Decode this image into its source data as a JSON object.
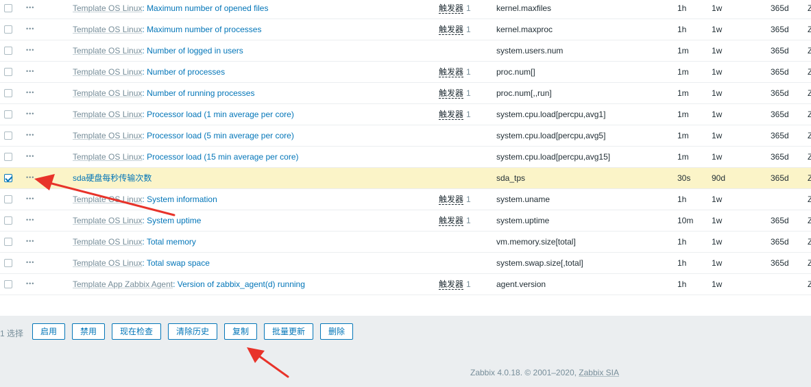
{
  "trigger_label": "触发器",
  "rows": [
    {
      "template": "Template OS Linux",
      "name": "Maximum number of opened files",
      "triggers": "1",
      "key": "kernel.maxfiles",
      "interval": "1h",
      "history": "1w",
      "trends": "365d",
      "type": "Z",
      "checked": false
    },
    {
      "template": "Template OS Linux",
      "name": "Maximum number of processes",
      "triggers": "1",
      "key": "kernel.maxproc",
      "interval": "1h",
      "history": "1w",
      "trends": "365d",
      "type": "Z",
      "checked": false
    },
    {
      "template": "Template OS Linux",
      "name": "Number of logged in users",
      "triggers": "",
      "key": "system.users.num",
      "interval": "1m",
      "history": "1w",
      "trends": "365d",
      "type": "Z",
      "checked": false
    },
    {
      "template": "Template OS Linux",
      "name": "Number of processes",
      "triggers": "1",
      "key": "proc.num[]",
      "interval": "1m",
      "history": "1w",
      "trends": "365d",
      "type": "Z",
      "checked": false
    },
    {
      "template": "Template OS Linux",
      "name": "Number of running processes",
      "triggers": "1",
      "key": "proc.num[,,run]",
      "interval": "1m",
      "history": "1w",
      "trends": "365d",
      "type": "Z",
      "checked": false
    },
    {
      "template": "Template OS Linux",
      "name": "Processor load (1 min average per core)",
      "triggers": "1",
      "key": "system.cpu.load[percpu,avg1]",
      "interval": "1m",
      "history": "1w",
      "trends": "365d",
      "type": "Z",
      "checked": false
    },
    {
      "template": "Template OS Linux",
      "name": "Processor load (5 min average per core)",
      "triggers": "",
      "key": "system.cpu.load[percpu,avg5]",
      "interval": "1m",
      "history": "1w",
      "trends": "365d",
      "type": "Z",
      "checked": false
    },
    {
      "template": "Template OS Linux",
      "name": "Processor load (15 min average per core)",
      "triggers": "",
      "key": "system.cpu.load[percpu,avg15]",
      "interval": "1m",
      "history": "1w",
      "trends": "365d",
      "type": "Z",
      "checked": false
    },
    {
      "template": "",
      "name": "sda硬盘每秒传输次数",
      "triggers": "",
      "key": "sda_tps",
      "interval": "30s",
      "history": "90d",
      "trends": "365d",
      "type": "Z",
      "checked": true
    },
    {
      "template": "Template OS Linux",
      "name": "System information",
      "triggers": "1",
      "key": "system.uname",
      "interval": "1h",
      "history": "1w",
      "trends": "",
      "type": "Z",
      "checked": false
    },
    {
      "template": "Template OS Linux",
      "name": "System uptime",
      "triggers": "1",
      "key": "system.uptime",
      "interval": "10m",
      "history": "1w",
      "trends": "365d",
      "type": "Z",
      "checked": false
    },
    {
      "template": "Template OS Linux",
      "name": "Total memory",
      "triggers": "",
      "key": "vm.memory.size[total]",
      "interval": "1h",
      "history": "1w",
      "trends": "365d",
      "type": "Z",
      "checked": false
    },
    {
      "template": "Template OS Linux",
      "name": "Total swap space",
      "triggers": "",
      "key": "system.swap.size[,total]",
      "interval": "1h",
      "history": "1w",
      "trends": "365d",
      "type": "Z",
      "checked": false
    },
    {
      "template": "Template App Zabbix Agent",
      "name": "Version of zabbix_agent(d) running",
      "triggers": "1",
      "key": "agent.version",
      "interval": "1h",
      "history": "1w",
      "trends": "",
      "type": "Z",
      "checked": false
    }
  ],
  "footer": {
    "selected_count": "1 选择",
    "buttons": [
      {
        "id": "enable",
        "label": "启用"
      },
      {
        "id": "disable",
        "label": "禁用"
      },
      {
        "id": "check-now",
        "label": "现在检查"
      },
      {
        "id": "clear-history",
        "label": "清除历史"
      },
      {
        "id": "copy",
        "label": "复制"
      },
      {
        "id": "mass-update",
        "label": "批量更新"
      },
      {
        "id": "delete",
        "label": "删除"
      }
    ],
    "copyright_text": "Zabbix 4.0.18. © 2001–2020, ",
    "copyright_link": "Zabbix SIA"
  },
  "colors": {
    "link": "#0275b8",
    "muted": "#768d99",
    "selected_row": "#fbf4c8",
    "footer_bg": "#ebeef0",
    "annotation_arrow": "#e8332a"
  }
}
